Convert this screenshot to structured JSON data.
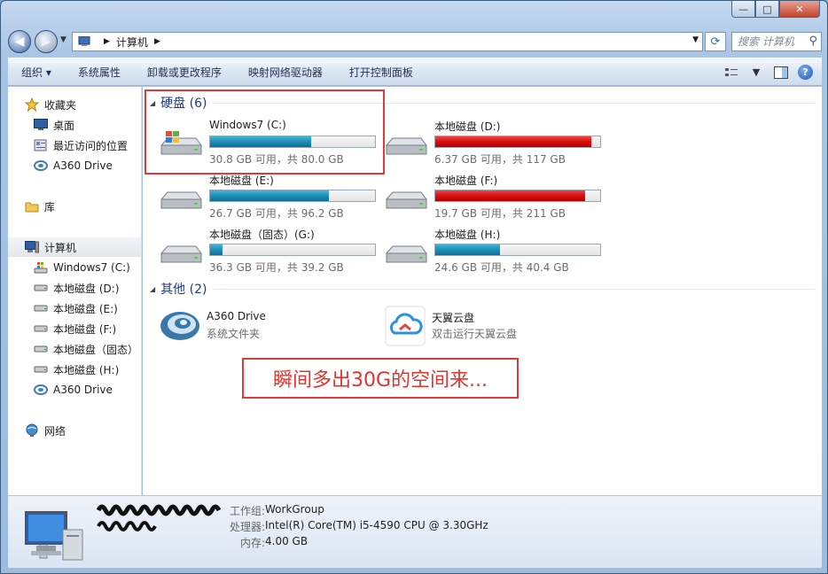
{
  "window": {
    "caption_buttons": {
      "minimize": "—",
      "maximize": "□",
      "close": "✕"
    }
  },
  "address_bar": {
    "path": "计算机",
    "search_placeholder": "搜索 计算机"
  },
  "toolbar": {
    "organize": "组织 ▾",
    "system_properties": "系统属性",
    "uninstall": "卸载或更改程序",
    "map_drive": "映射网络驱动器",
    "control_panel": "打开控制面板"
  },
  "sidebar": {
    "favorites": "收藏夹",
    "desktop": "桌面",
    "recent": "最近访问的位置",
    "a360": "A360 Drive",
    "libraries": "库",
    "computer": "计算机",
    "drives": [
      {
        "label": "Windows7 (C:)"
      },
      {
        "label": "本地磁盘 (D:)"
      },
      {
        "label": "本地磁盘 (E:)"
      },
      {
        "label": "本地磁盘 (F:)"
      },
      {
        "label": "本地磁盘（固态）"
      },
      {
        "label": "本地磁盘 (H:)"
      },
      {
        "label": "A360 Drive"
      }
    ],
    "network": "网络"
  },
  "content": {
    "hard_disks_header": "硬盘 (6)",
    "other_header": "其他 (2)",
    "drives": [
      {
        "name": "Windows7 (C:)",
        "info": "30.8 GB 可用，共 80.0 GB",
        "used_fraction": 0.615,
        "color": "blue"
      },
      {
        "name": "本地磁盘 (D:)",
        "info": "6.37 GB 可用，共 117 GB",
        "used_fraction": 0.946,
        "color": "red"
      },
      {
        "name": "本地磁盘 (E:)",
        "info": "26.7 GB 可用，共 96.2 GB",
        "used_fraction": 0.722,
        "color": "blue"
      },
      {
        "name": "本地磁盘 (F:)",
        "info": "19.7 GB 可用，共 211 GB",
        "used_fraction": 0.907,
        "color": "red"
      },
      {
        "name": "本地磁盘（固态）(G:)",
        "info": "36.3 GB 可用，共 39.2 GB",
        "used_fraction": 0.074,
        "color": "blue"
      },
      {
        "name": "本地磁盘 (H:)",
        "info": "24.6 GB 可用，共 40.4 GB",
        "used_fraction": 0.391,
        "color": "blue"
      }
    ],
    "other": [
      {
        "name": "A360 Drive",
        "sub": "系统文件夹"
      },
      {
        "name": "天翼云盘",
        "sub": "双击运行天翼云盘"
      }
    ],
    "annotation": "瞬间多出30G的空间来..."
  },
  "details": {
    "workgroup_key": "工作组:",
    "workgroup": "WorkGroup",
    "cpu_key": "处理器:",
    "cpu": "Intel(R) Core(TM) i5-4590 CPU @ 3.30GHz",
    "ram_key": "内存:",
    "ram": "4.00 GB"
  },
  "colors": {
    "accent_red": "#e23a3a",
    "group_header": "#1e3b8a"
  }
}
